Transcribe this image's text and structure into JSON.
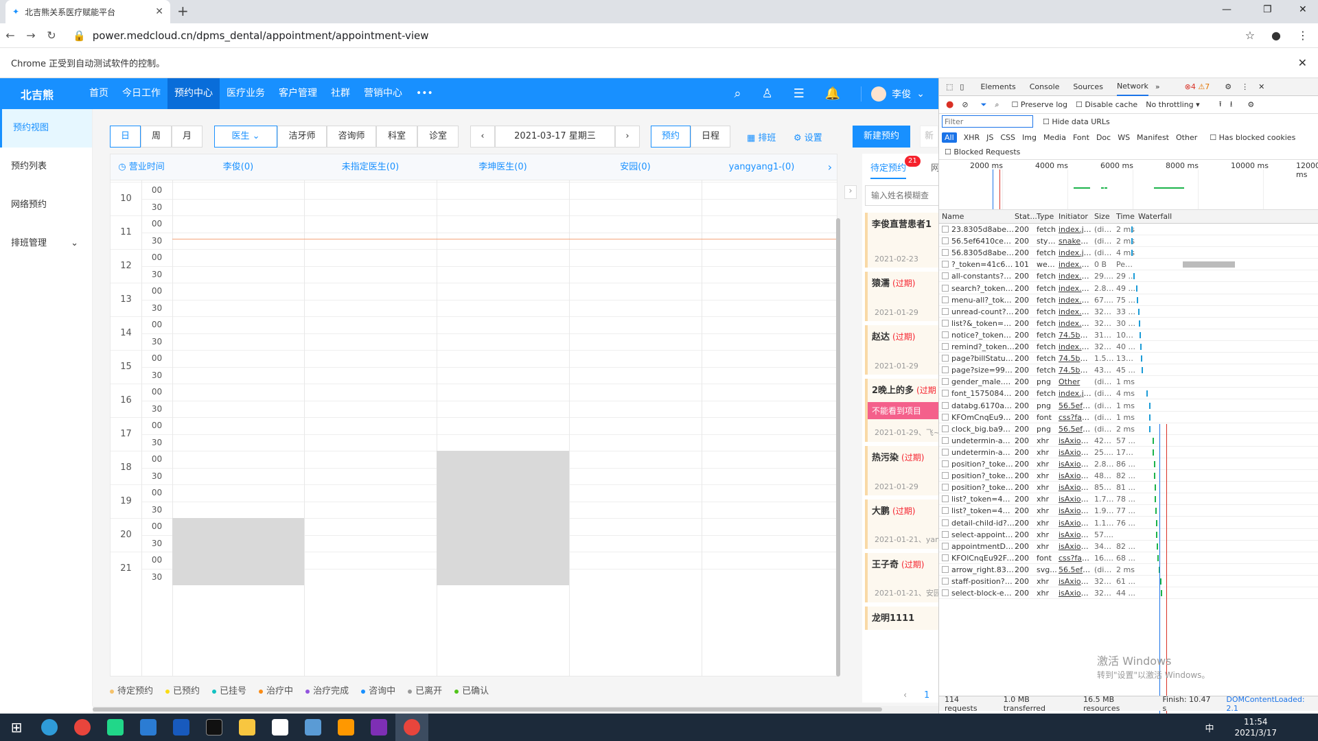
{
  "browser": {
    "tab_title": "北吉熊关系医疗赋能平台",
    "url": "power.medcloud.cn/dpms_dental/appointment/appointment-view",
    "info": "Chrome 正受到自动测试软件的控制。"
  },
  "header": {
    "logo": "北吉熊",
    "nav": [
      "首页",
      "今日工作",
      "预约中心",
      "医疗业务",
      "客户管理",
      "社群",
      "营销中心",
      "•••"
    ],
    "user": "李俊"
  },
  "sidebar": [
    "预约视图",
    "预约列表",
    "网络预约",
    "排班管理"
  ],
  "toolbar": {
    "view": [
      "日",
      "周",
      "月"
    ],
    "roles": [
      "医生",
      "洁牙师",
      "咨询师",
      "科室",
      "诊室"
    ],
    "date": "2021-03-17  星期三",
    "modes": [
      "预约",
      "日程"
    ],
    "schedule": "排班",
    "settings": "设置",
    "new": "新建预约",
    "extra": "新"
  },
  "calendar": {
    "time_header": "营业时间",
    "doctors": [
      "李俊(0)",
      "未指定医生(0)",
      "李坤医生(0)",
      "安园(0)",
      "yangyang1-(0)"
    ],
    "hours": [
      "10",
      "11",
      "12",
      "13",
      "14",
      "15",
      "16",
      "17",
      "18",
      "19",
      "20",
      "21"
    ],
    "mins": [
      "00",
      "30"
    ]
  },
  "legend": [
    {
      "label": "待定预约",
      "color": "#f5c26b"
    },
    {
      "label": "已预约",
      "color": "#fadb14"
    },
    {
      "label": "已挂号",
      "color": "#13c2c2"
    },
    {
      "label": "治疗中",
      "color": "#fa8c16"
    },
    {
      "label": "治疗完成",
      "color": "#9254de"
    },
    {
      "label": "咨询中",
      "color": "#1890ff"
    },
    {
      "label": "已离开",
      "color": "#999999"
    },
    {
      "label": "已确认",
      "color": "#52c41a"
    }
  ],
  "panel": {
    "tab": "待定预约",
    "badge": "21",
    "tab2": "网",
    "search": "输入姓名模糊查",
    "cards": [
      {
        "name": "李俊直营患者1",
        "overdue": "",
        "date": "2021-02-23",
        "tag": ""
      },
      {
        "name": "猿濡",
        "overdue": "(过期)",
        "date": "2021-01-29",
        "tag": ""
      },
      {
        "name": "赵达",
        "overdue": "(过期)",
        "date": "2021-01-29",
        "tag": ""
      },
      {
        "name": "2晚上的多",
        "overdue": "(过期",
        "date": "2021-01-29、飞~",
        "tag": "不能看到项目"
      },
      {
        "name": "热污染",
        "overdue": "(过期)",
        "date": "2021-01-29",
        "tag": ""
      },
      {
        "name": "大鹏",
        "overdue": "(过期)",
        "date": "2021-01-21、yan",
        "tag": ""
      },
      {
        "name": "王子奇",
        "overdue": "(过期)",
        "date": "2021-01-21、安园",
        "tag": ""
      },
      {
        "name": "龙明1111",
        "overdue": "",
        "date": "",
        "tag": ""
      }
    ],
    "page": "1"
  },
  "devtools": {
    "tabs": [
      "Elements",
      "Console",
      "Sources",
      "Network"
    ],
    "errors": "4",
    "warnings": "7",
    "filter": "Filter",
    "options": [
      "Preserve log",
      "Disable cache",
      "No throttling"
    ],
    "hide": "Hide data URLs",
    "types": [
      "All",
      "XHR",
      "JS",
      "CSS",
      "Img",
      "Media",
      "Font",
      "Doc",
      "WS",
      "Manifest",
      "Other"
    ],
    "blocked_cookies": "Has blocked cookies",
    "blocked": "Blocked Requests",
    "timeline": [
      "2000 ms",
      "4000 ms",
      "6000 ms",
      "8000 ms",
      "10000 ms",
      "12000 ms"
    ],
    "cols": [
      "Name",
      "Stat...",
      "Type",
      "Initiator",
      "Size",
      "Time",
      "Waterfall"
    ],
    "rows": [
      [
        "23.8305d8abeb0...",
        "200",
        "fetch",
        "index.js:82",
        "(dis...",
        "2 ms"
      ],
      [
        "56.5ef6410ce928...",
        "200",
        "styl...",
        "snakeCa...",
        "(dis...",
        "2 ms"
      ],
      [
        "56.8305d8abeb6f...",
        "200",
        "fetch",
        "index.js:82",
        "(dis...",
        "4 ms"
      ],
      [
        "?_token=41c6da6...",
        "101",
        "web...",
        "index.ed...",
        "0 B",
        "Pen..."
      ],
      [
        "all-constants?_tok...",
        "200",
        "fetch",
        "index.ed...",
        "29....",
        "29 ..."
      ],
      [
        "search?_token=4...",
        "200",
        "fetch",
        "index.ed...",
        "2.8 ...",
        "49 ..."
      ],
      [
        "menu-all?_token...",
        "200",
        "fetch",
        "index.ed...",
        "67....",
        "75 ..."
      ],
      [
        "unread-count?_to...",
        "200",
        "fetch",
        "index.ed...",
        "321 B",
        "33 ..."
      ],
      [
        "list?&_token=41c...",
        "200",
        "fetch",
        "index.ed...",
        "322 B",
        "30 ..."
      ],
      [
        "notice?_token=41...",
        "200",
        "fetch",
        "74.5be.js:1",
        "311 B",
        "103..."
      ],
      [
        "remind?_token=4...",
        "200",
        "fetch",
        "index.ed...",
        "322 B",
        "40 ..."
      ],
      [
        "page?billStatus=1...",
        "200",
        "fetch",
        "74.5be.js:1",
        "1.5 ...",
        "130..."
      ],
      [
        "page?size=999&c...",
        "200",
        "fetch",
        "74.5be.js:1",
        "430 B",
        "45 ..."
      ],
      [
        "gender_male.png",
        "200",
        "png",
        "Other",
        "(dis...",
        "1 ms"
      ],
      [
        "font_1575084_4h...",
        "200",
        "fetch",
        "index.js:82",
        "(dis...",
        "4 ms"
      ],
      [
        "databg.6170abf.p...",
        "200",
        "png",
        "56.5ef64...",
        "(dis...",
        "1 ms"
      ],
      [
        "KFOmCnqEu92Fr...",
        "200",
        "font",
        "css?fami...",
        "(dis...",
        "1 ms"
      ],
      [
        "clock_big.ba9156...",
        "200",
        "png",
        "56.5ef64...",
        "(dis...",
        "2 ms"
      ],
      [
        "undetermin-appo...",
        "200",
        "xhr",
        "isAxiosE...",
        "429 B",
        "57 ..."
      ],
      [
        "undetermin-appo...",
        "200",
        "xhr",
        "isAxiosE...",
        "25....",
        "173..."
      ],
      [
        "position?_token=...",
        "200",
        "xhr",
        "isAxiosE...",
        "2.8 ...",
        "86 ..."
      ],
      [
        "position?_token=...",
        "200",
        "xhr",
        "isAxiosE...",
        "480 B",
        "82 ..."
      ],
      [
        "position?_token=...",
        "200",
        "xhr",
        "isAxiosE...",
        "855 B",
        "81 ..."
      ],
      [
        "list?_token=41c6...",
        "200",
        "xhr",
        "isAxiosE...",
        "1.7 ...",
        "78 ..."
      ],
      [
        "list?_token=41c6...",
        "200",
        "xhr",
        "isAxiosE...",
        "1.9 ...",
        "77 ..."
      ],
      [
        "detail-child-id?_t...",
        "200",
        "xhr",
        "isAxiosE...",
        "1.1 ...",
        "76 ..."
      ],
      [
        "select-appointme...",
        "200",
        "xhr",
        "isAxiosE...",
        "57....",
        ""
      ],
      [
        "appointmentDayS...",
        "200",
        "xhr",
        "isAxiosE...",
        "343 B",
        "82 ..."
      ],
      [
        "KFOlCnqEu92Fr1...",
        "200",
        "font",
        "css?fami...",
        "16....",
        "68 ..."
      ],
      [
        "arrow_right.83ab...",
        "200",
        "svg...",
        "56.5ef64...",
        "(dis...",
        "2 ms"
      ],
      [
        "staff-position?_to...",
        "200",
        "xhr",
        "isAxiosE...",
        "326 B",
        "61 ..."
      ],
      [
        "select-block-even...",
        "200",
        "xhr",
        "isAxiosE...",
        "326 B",
        "44 ..."
      ]
    ],
    "status": [
      "114 requests",
      "1.0 MB transferred",
      "16.5 MB resources",
      "Finish: 10.47 s",
      "DOMContentLoaded: 2.1"
    ],
    "watermark": "激活 Windows",
    "watermark2": "转到\"设置\"以激活 Windows。"
  },
  "taskbar": {
    "time": "11:54",
    "date": "2021/3/17",
    "ime": "中"
  }
}
